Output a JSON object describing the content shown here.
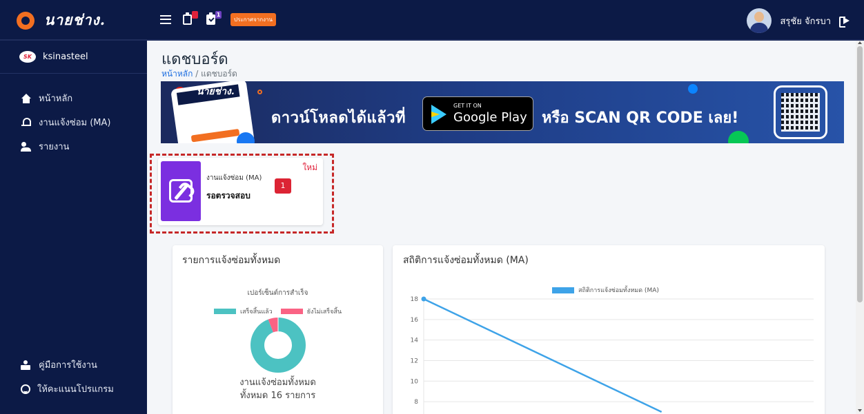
{
  "brand": {
    "name": "นายช่าง."
  },
  "topbar": {
    "notif_assign_count": "",
    "notif_check_count": "1",
    "announce_label": "ประกาศจากงาน",
    "user_name": "สรุชัย จักรบา"
  },
  "sidebar": {
    "company": "ksinasteel",
    "company_logo_text": "SK",
    "items": [
      {
        "label": "หน้าหลัก"
      },
      {
        "label": "งานแจ้งซ่อม (MA)"
      },
      {
        "label": "รายงาน"
      }
    ],
    "bottom_items": [
      {
        "label": "คู่มือการใช้งาน"
      },
      {
        "label": "ให้คะแนนโปรแกรม"
      }
    ]
  },
  "page": {
    "title": "แดชบอร์ด",
    "breadcrumb_home": "หน้าหลัก",
    "breadcrumb_sep": "/",
    "breadcrumb_current": "แดชบอร์ด"
  },
  "banner": {
    "logo": "นายช่าง.",
    "download_text": "ดาวน์โหลดได้แล้วที่",
    "gplay_small": "GET IT ON",
    "gplay_big": "Google Play",
    "scan_text": "หรือ SCAN QR CODE เลย!"
  },
  "job_card": {
    "new_label": "ใหม่",
    "label": "งานแจ้งซ่อม (MA)",
    "status": "รอตรวจสอบ",
    "count": "1"
  },
  "card_summary": {
    "title": "รายการแจ้งซ่อมทั้งหมด",
    "caption_line1": "งานแจ้งซ่อมทั้งหมด",
    "caption_line2": "ทั้งหมด 16 รายการ"
  },
  "card_stats": {
    "title": "สถิติการแจ้งซ่อมทั้งหมด (MA)"
  },
  "colors": {
    "nav_bg": "#0c1a46",
    "accent_orange": "#f26f21",
    "done_teal": "#4cc2c2",
    "pending_pink": "#fa6384",
    "line_blue": "#3ea3e8",
    "badge_red": "#dc2434"
  },
  "chart_data": [
    {
      "type": "pie",
      "title": "เปอร์เซ็นต์การสำเร็จ",
      "categories": [
        "เสร็จสิ้นแล้ว",
        "ยังไม่เสร็จสิ้น"
      ],
      "values": [
        94,
        6
      ],
      "colors": [
        "#4cc2c2",
        "#fa6384"
      ],
      "legend": "top"
    },
    {
      "type": "line",
      "series": [
        {
          "name": "สถิติการแจ้งซ่อมทั้งหมด (MA)",
          "values": [
            18,
            7
          ]
        }
      ],
      "x": [
        0,
        1
      ],
      "ylim": [
        7,
        18
      ],
      "yticks": [
        "18",
        "16",
        "14",
        "12",
        "10",
        "8"
      ],
      "grid": true,
      "legend": "top"
    }
  ]
}
